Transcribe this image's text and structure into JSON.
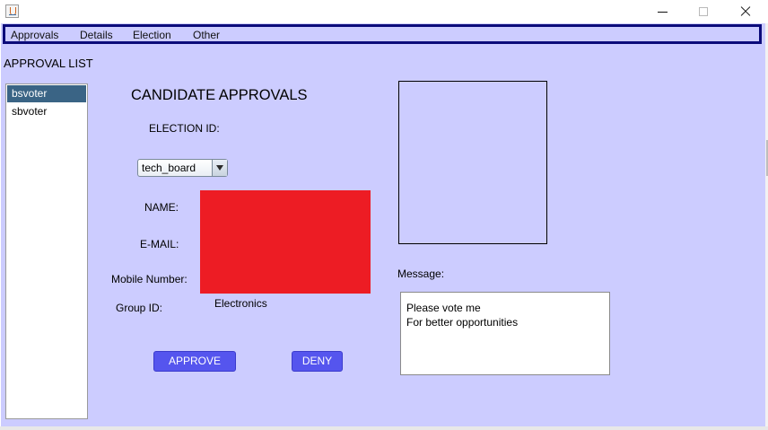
{
  "window": {
    "icon": "java-cup-icon",
    "controls": [
      "minimize-icon",
      "maximize-icon",
      "close-icon"
    ]
  },
  "menu": {
    "items": [
      "Approvals",
      "Details",
      "Election",
      "Other"
    ]
  },
  "approval_list": {
    "title": "APPROVAL LIST",
    "items": [
      "bsvoter",
      "sbvoter"
    ],
    "selected": "bsvoter"
  },
  "form": {
    "title": "CANDIDATE APPROVALS",
    "election_id_label": "ELECTION  ID:",
    "election_id_value": "tech_board",
    "name_label": "NAME:",
    "email_label": "E-MAIL:",
    "mobile_label": "Mobile Number:",
    "group_id_label": "Group ID:",
    "group_id_value": "Electronics",
    "redaction_color": "#ed1c24"
  },
  "message": {
    "label": "Message:",
    "lines": [
      "Please vote me",
      "For better opportunities"
    ]
  },
  "buttons": {
    "approve": "APPROVE",
    "deny": "DENY"
  },
  "colors": {
    "background": "#ccccff",
    "menu_border": "#0b0b7a",
    "button": "#5555ee",
    "selection": "#3a6485"
  }
}
